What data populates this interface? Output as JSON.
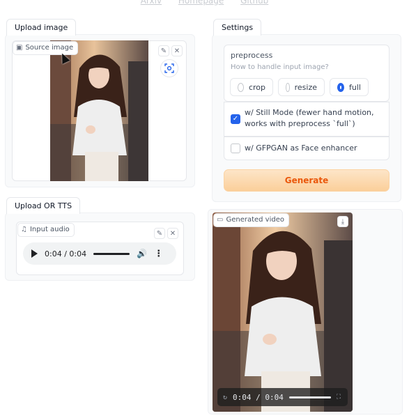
{
  "topnav": {
    "links": [
      "Arxiv",
      "Homepage",
      "Github"
    ]
  },
  "upload_image": {
    "tab_label": "Upload image",
    "source_chip_label": "Source image",
    "edit_icon": "pencil-icon",
    "clear_icon": "close-icon",
    "focus_icon": "focus-icon"
  },
  "upload_audio": {
    "tab_label": "Upload OR TTS",
    "input_chip_label": "Input audio",
    "time_display": "0:04 / 0:04"
  },
  "settings": {
    "tab_label": "Settings",
    "preprocess_label": "preprocess",
    "preprocess_info": "How to handle input image?",
    "options": [
      "crop",
      "resize",
      "full"
    ],
    "selected": "full",
    "still_mode_label": "w/ Still Mode (fewer hand motion, works with preprocess `full`)",
    "still_mode_checked": true,
    "gfpgan_label": "w/ GFPGAN as Face enhancer",
    "gfpgan_checked": false,
    "generate_label": "Generate"
  },
  "generated": {
    "chip_label": "Generated video",
    "time_display": "0:04 / 0:04"
  },
  "colors": {
    "accent": "#2563eb",
    "generate_text": "#ea580c"
  }
}
